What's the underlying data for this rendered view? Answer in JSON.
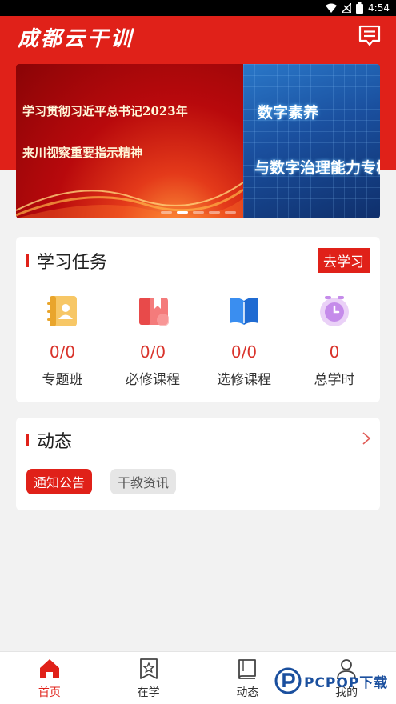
{
  "status_bar": {
    "time": "4:54"
  },
  "header": {
    "logo_text": "成都云干训"
  },
  "banner": {
    "slide1_line1": "学习贯彻习近平总书记2023年",
    "slide1_line2": "来川视察重要指示精神",
    "slide2_line1": "数字素养",
    "slide2_line2": "与数字治理能力专栏",
    "active_dot": 1
  },
  "tasks": {
    "title": "学习任务",
    "go_button": "去学习",
    "stats": [
      {
        "value": "0/0",
        "label": "专题班",
        "icon": "contact-book-icon",
        "color": "#f2b13a"
      },
      {
        "value": "0/0",
        "label": "必修课程",
        "icon": "bookmark-book-icon",
        "color": "#ef5a5a"
      },
      {
        "value": "0/0",
        "label": "选修课程",
        "icon": "open-book-icon",
        "color": "#2f7ee0"
      },
      {
        "value": "0",
        "label": "总学时",
        "icon": "clock-icon",
        "color": "#c58bea"
      }
    ]
  },
  "news": {
    "title": "动态",
    "tabs": [
      {
        "label": "通知公告"
      },
      {
        "label": "干教资讯"
      }
    ]
  },
  "tabbar": {
    "items": [
      {
        "label": "首页",
        "icon": "home-icon"
      },
      {
        "label": "在学",
        "icon": "star-book-icon"
      },
      {
        "label": "动态",
        "icon": "book-icon"
      },
      {
        "label": "我的",
        "icon": "user-icon"
      }
    ],
    "active": 0
  },
  "watermark": {
    "text": "PCPOP下载"
  },
  "colors": {
    "brand": "#e02119",
    "value": "#d9332b"
  }
}
